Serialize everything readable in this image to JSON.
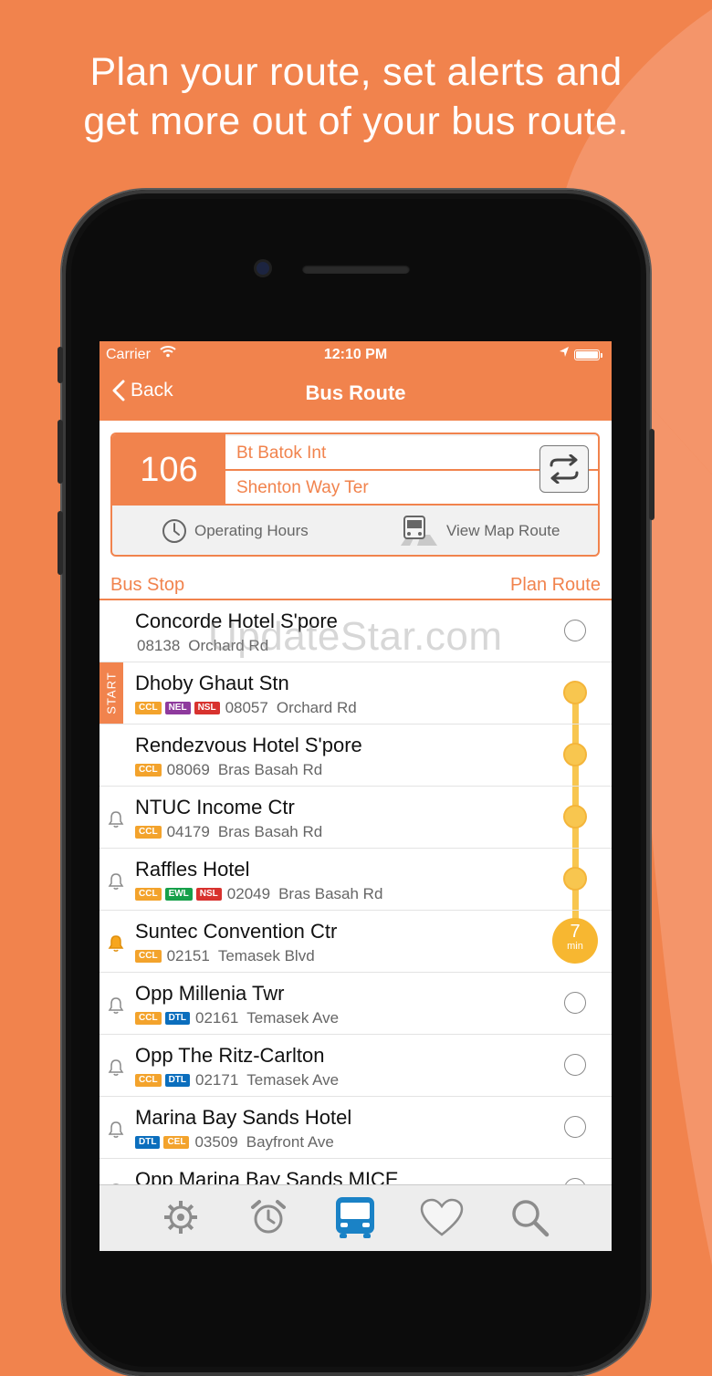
{
  "headline": {
    "line1": "Plan your route, set alerts and",
    "line2": "get more out of your bus route."
  },
  "status_bar": {
    "carrier": "Carrier",
    "time": "12:10 PM"
  },
  "nav": {
    "back_label": "Back",
    "title": "Bus Route"
  },
  "route": {
    "number": "106",
    "from": "Bt Batok Int",
    "to": "Shenton Way Ter",
    "operating_hours_label": "Operating Hours",
    "view_map_label": "View Map Route"
  },
  "section": {
    "left": "Bus Stop",
    "right": "Plan Route"
  },
  "line_badges": {
    "CCL": "#f3a32c",
    "NEL": "#8e3a9d",
    "NSL": "#d8322e",
    "EWL": "#16a04a",
    "DTL": "#0b6ebd",
    "CEL": "#f3a32c"
  },
  "stops": [
    {
      "name": "Concorde Hotel S'pore",
      "lines": [],
      "code": "08138",
      "road": "Orchard Rd",
      "bell": "none",
      "start": false,
      "marker": "radio"
    },
    {
      "name": "Dhoby Ghaut Stn",
      "lines": [
        "CCL",
        "NEL",
        "NSL"
      ],
      "code": "08057",
      "road": "Orchard Rd",
      "bell": "none",
      "start": true,
      "marker": "dot"
    },
    {
      "name": "Rendezvous Hotel S'pore",
      "lines": [
        "CCL"
      ],
      "code": "08069",
      "road": "Bras Basah Rd",
      "bell": "none",
      "start": false,
      "marker": "dot"
    },
    {
      "name": "NTUC Income Ctr",
      "lines": [
        "CCL"
      ],
      "code": "04179",
      "road": "Bras Basah Rd",
      "bell": "off",
      "start": false,
      "marker": "dot"
    },
    {
      "name": "Raffles Hotel",
      "lines": [
        "CCL",
        "EWL",
        "NSL"
      ],
      "code": "02049",
      "road": "Bras Basah Rd",
      "bell": "off",
      "start": false,
      "marker": "dot"
    },
    {
      "name": "Suntec Convention Ctr",
      "lines": [
        "CCL"
      ],
      "code": "02151",
      "road": "Temasek Blvd",
      "bell": "on",
      "start": false,
      "marker": "eta",
      "eta_value": "7",
      "eta_unit": "min"
    },
    {
      "name": "Opp Millenia Twr",
      "lines": [
        "CCL",
        "DTL"
      ],
      "code": "02161",
      "road": "Temasek Ave",
      "bell": "off",
      "start": false,
      "marker": "radio"
    },
    {
      "name": "Opp The Ritz-Carlton",
      "lines": [
        "CCL",
        "DTL"
      ],
      "code": "02171",
      "road": "Temasek Ave",
      "bell": "off",
      "start": false,
      "marker": "radio"
    },
    {
      "name": "Marina Bay Sands Hotel",
      "lines": [
        "DTL",
        "CEL"
      ],
      "code": "03509",
      "road": "Bayfront Ave",
      "bell": "off",
      "start": false,
      "marker": "radio"
    },
    {
      "name": "Opp Marina Bay Sands MICE",
      "lines": [],
      "code": "",
      "road": "",
      "bell": "off",
      "start": false,
      "marker": "radio"
    }
  ],
  "start_label": "START",
  "tabs": [
    {
      "icon": "settings-icon",
      "active": false
    },
    {
      "icon": "alarm-clock-icon",
      "active": false
    },
    {
      "icon": "bus-icon",
      "active": true
    },
    {
      "icon": "heart-icon",
      "active": false
    },
    {
      "icon": "search-icon",
      "active": false
    }
  ],
  "watermark": "UpdateStar.com"
}
